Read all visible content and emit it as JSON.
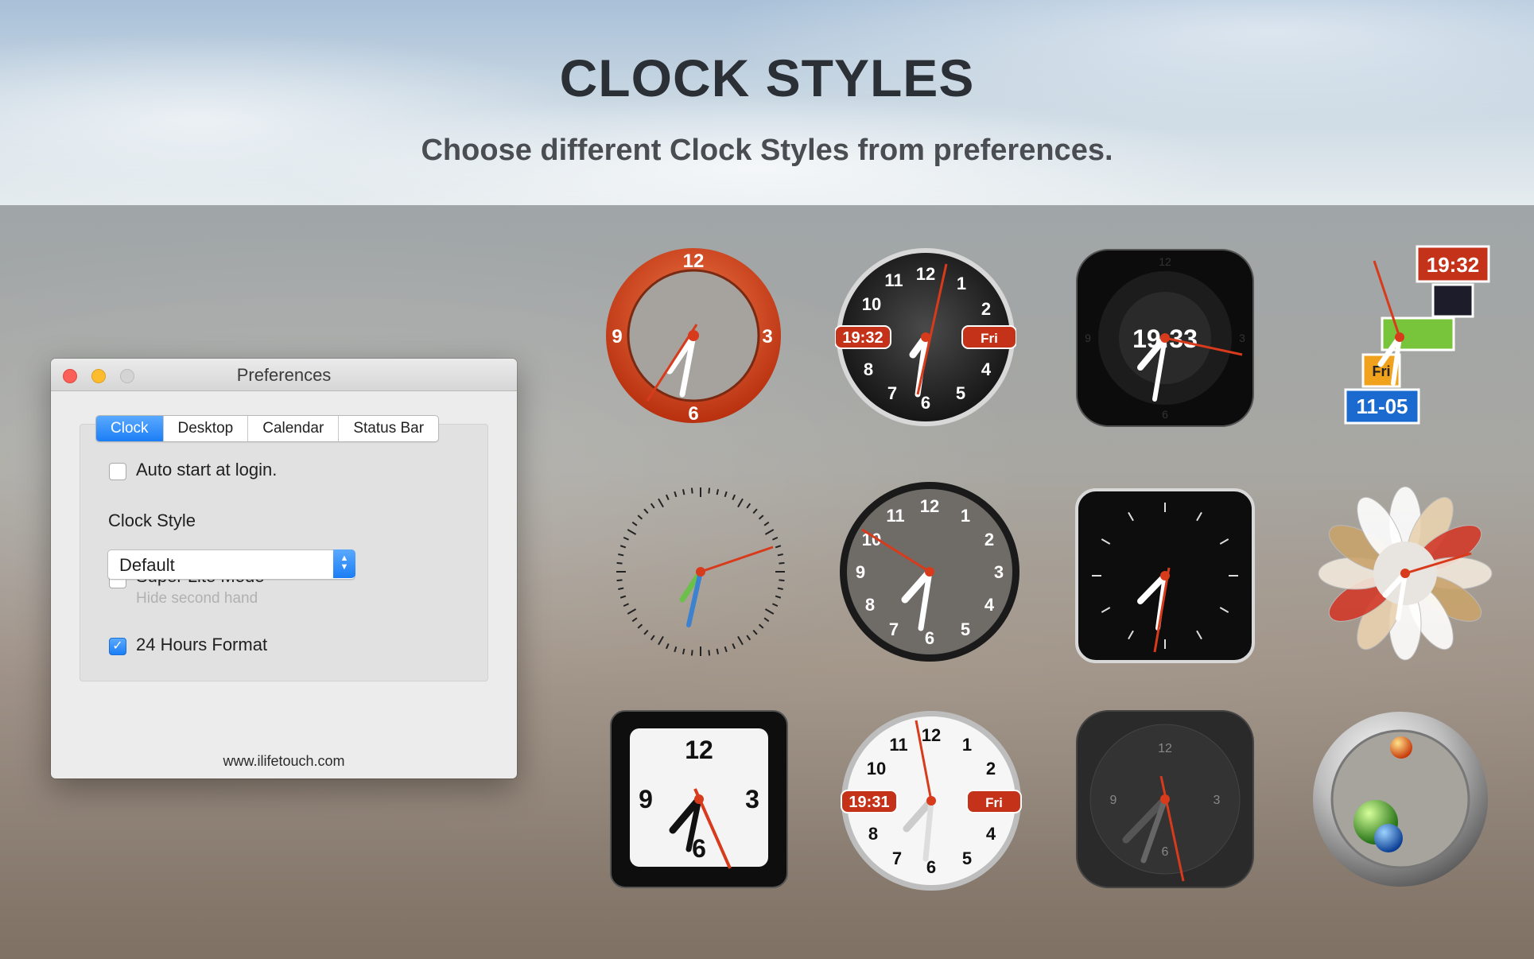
{
  "hero": {
    "title": "CLOCK STYLES",
    "subtitle": "Choose different Clock Styles from preferences."
  },
  "window": {
    "title": "Preferences",
    "tabs": [
      {
        "label": "Clock",
        "active": true
      },
      {
        "label": "Desktop",
        "active": false
      },
      {
        "label": "Calendar",
        "active": false
      },
      {
        "label": "Status Bar",
        "active": false
      }
    ],
    "auto_start": {
      "label": "Auto start at login.",
      "checked": false
    },
    "clock_style": {
      "label": "Clock Style",
      "value": "Default"
    },
    "super_lite": {
      "label": "Super Lite Mode",
      "hint": "Hide second hand",
      "checked": false
    },
    "hours24": {
      "label": "24 Hours Format",
      "checked": true
    },
    "footer": "www.ilifetouch.com"
  },
  "clocks": {
    "c1": {
      "n12": "12",
      "n3": "3",
      "n6": "6",
      "n9": "9"
    },
    "c2": {
      "n12": "12",
      "n1": "1",
      "n2": "2",
      "n4": "4",
      "n5": "5",
      "n6": "6",
      "n7": "7",
      "n8": "8",
      "n10": "10",
      "n11": "11",
      "time": "19:32",
      "day": "Fri"
    },
    "c3": {
      "n12": "12",
      "n3": "3",
      "n6": "6",
      "n9": "9",
      "time": "19:33"
    },
    "c4": {
      "time": "19:32",
      "day": "Fri",
      "date": "11-05"
    },
    "c6": {
      "n12": "12",
      "n1": "1",
      "n2": "2",
      "n3": "3",
      "n4": "4",
      "n5": "5",
      "n6": "6",
      "n7": "7",
      "n8": "8",
      "n9": "9",
      "n10": "10",
      "n11": "11"
    },
    "c9": {
      "n12": "12",
      "n3": "3",
      "n6": "6",
      "n9": "9"
    },
    "c10": {
      "n12": "12",
      "n1": "1",
      "n2": "2",
      "n4": "4",
      "n5": "5",
      "n6": "6",
      "n7": "7",
      "n8": "8",
      "n10": "10",
      "n11": "11",
      "time": "19:31",
      "day": "Fri"
    },
    "c11": {
      "n12": "12",
      "n3": "3",
      "n6": "6",
      "n9": "9"
    }
  },
  "colors": {
    "accent": "#1b7ef5",
    "clock_red": "#d83a1c"
  }
}
